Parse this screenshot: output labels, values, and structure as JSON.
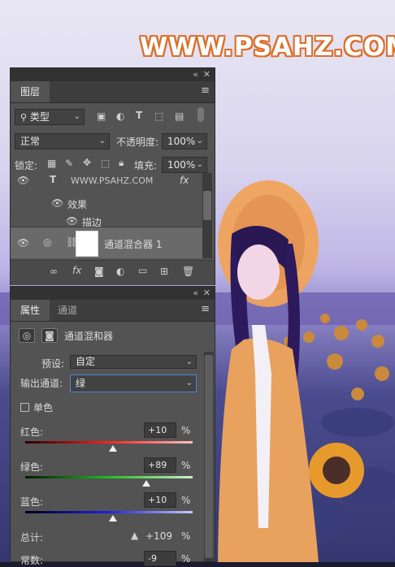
{
  "watermark": "WWW.PSAHZ.COM",
  "colors": {
    "panel_bg": "#535353",
    "tab_bg": "#3e3e3e",
    "selected_row": "#6a6a6a",
    "accent_border": "#4c87d6"
  },
  "layers_panel": {
    "tabs": [
      {
        "label": "图层",
        "active": true
      }
    ],
    "filter": {
      "label": "类型"
    },
    "filter_icons": [
      "image-filter-icon",
      "adjustment-filter-icon",
      "text-filter-icon",
      "shape-filter-icon",
      "smart-object-filter-icon"
    ],
    "blend_mode": "正常",
    "opacity_label": "不透明度:",
    "opacity_value": "100%",
    "lock_label": "锁定:",
    "fill_label": "填充:",
    "fill_value": "100%",
    "layers": [
      {
        "name": "WWW.PSAHZ.COM",
        "type": "text",
        "fx": "fx"
      },
      {
        "name": "效果",
        "type": "effects"
      },
      {
        "name": "描边",
        "type": "effect"
      },
      {
        "name": "通道混合器 1",
        "type": "adjustment",
        "selected": true
      }
    ],
    "bottom_icons": [
      "link-layers-icon",
      "fx-icon",
      "mask-icon",
      "adjustment-icon",
      "group-icon",
      "new-layer-icon",
      "trash-icon"
    ]
  },
  "properties_panel": {
    "tabs": [
      {
        "label": "属性",
        "active": true
      },
      {
        "label": "通道",
        "active": false
      }
    ],
    "title": "通道混和器",
    "preset_label": "预设:",
    "preset_value": "自定",
    "output_label": "输出通道:",
    "output_value": "绿",
    "mono_label": "单色",
    "mono_checked": false,
    "channels": [
      {
        "label": "红色:",
        "value": "+10",
        "percent": 10,
        "unit": "%"
      },
      {
        "label": "绿色:",
        "value": "+89",
        "percent": 89,
        "unit": "%"
      },
      {
        "label": "蓝色:",
        "value": "+10",
        "percent": 10,
        "unit": "%"
      }
    ],
    "total_label": "总计:",
    "total_value": "+109",
    "total_unit": "%",
    "constant_label": "常数:",
    "constant_value": "-9",
    "constant_unit": "%"
  }
}
